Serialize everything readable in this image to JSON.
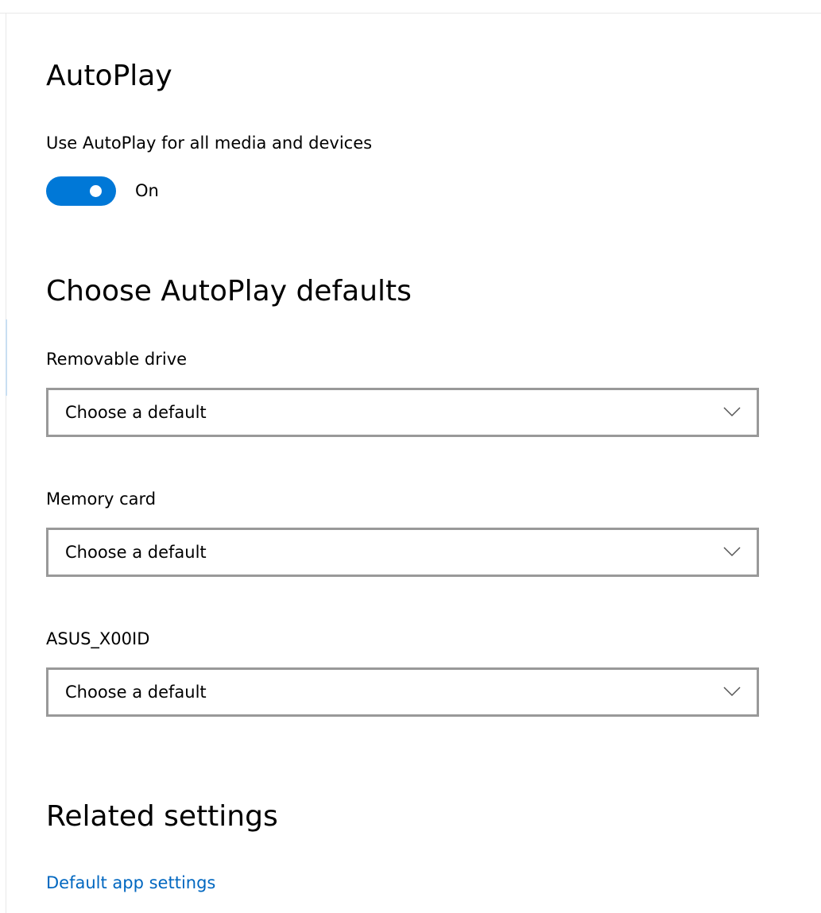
{
  "autoplay": {
    "title": "AutoPlay",
    "toggle_label": "Use AutoPlay for all media and devices",
    "toggle_state": "On"
  },
  "defaults": {
    "title": "Choose AutoPlay defaults",
    "items": [
      {
        "label": "Removable drive",
        "value": "Choose a default"
      },
      {
        "label": "Memory card",
        "value": "Choose a default"
      },
      {
        "label": "ASUS_X00ID",
        "value": "Choose a default"
      }
    ]
  },
  "related": {
    "title": "Related settings",
    "link": "Default app settings"
  },
  "colors": {
    "accent": "#0078d7",
    "link": "#0067c0",
    "dropdown_border": "#999999"
  },
  "icons": {
    "dropdown": "chevron-down-icon"
  }
}
